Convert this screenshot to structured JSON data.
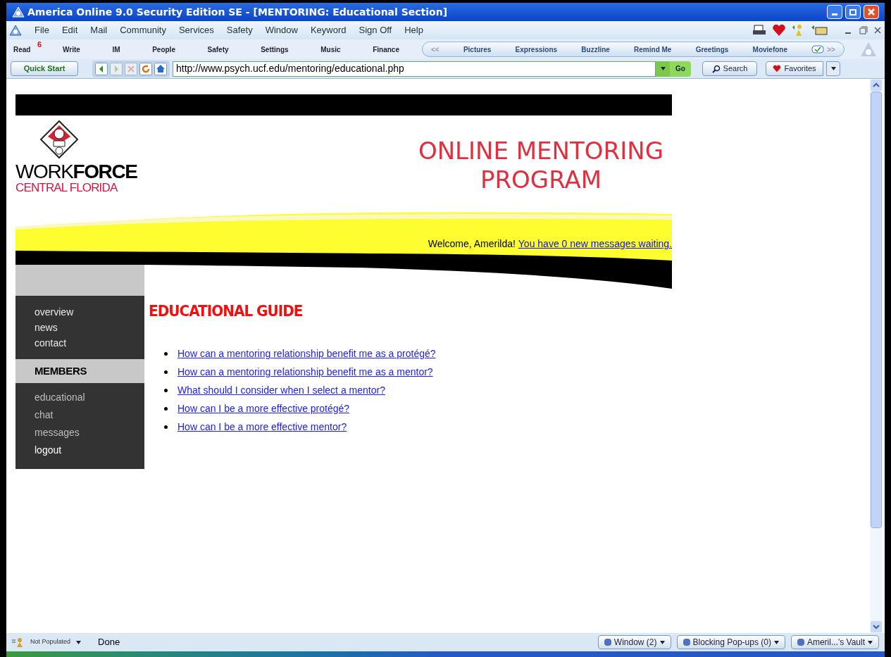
{
  "window": {
    "title": "America Online 9.0 Security Edition SE - [MENTORING: Educational Section]"
  },
  "menu": [
    "File",
    "Edit",
    "Mail",
    "Community",
    "Services",
    "Safety",
    "Window",
    "Keyword",
    "Sign Off",
    "Help"
  ],
  "toolbar": [
    {
      "label": "Read",
      "badge": "6"
    },
    {
      "label": "Write"
    },
    {
      "label": "IM"
    },
    {
      "label": "People"
    },
    {
      "label": "Safety"
    },
    {
      "label": "Settings"
    },
    {
      "label": "Music"
    },
    {
      "label": "Finance"
    }
  ],
  "toolbar2": {
    "back": "<<",
    "items": [
      "Pictures",
      "Expressions",
      "Buzzline",
      "Remind Me",
      "Greetings",
      "Moviefone"
    ],
    "more": ">>"
  },
  "address_bar": {
    "quick_start": "Quick Start",
    "url": "http://www.psych.ucf.edu/mentoring/educational.php",
    "go": "Go",
    "search": "Search",
    "favorites": "Favorites"
  },
  "page": {
    "logo": {
      "line1_thin": "WORK",
      "line1_bold": "FORCE",
      "line2": "CENTRAL FLORIDA"
    },
    "title_lines": [
      "ONLINE MENTORING",
      "PROGRAM"
    ],
    "welcome": "Welcome, Amerilda!",
    "messages_link": "You have 0 new messages waiting.",
    "nav": [
      {
        "label": "overview",
        "bright": false
      },
      {
        "label": "news",
        "bright": false
      },
      {
        "label": "contact",
        "bright": false
      }
    ],
    "members_heading": "MEMBERS",
    "members_nav": [
      {
        "label": "educational",
        "bright": false
      },
      {
        "label": "chat",
        "bright": false
      },
      {
        "label": "messages",
        "bright": false
      },
      {
        "label": "logout",
        "bright": true
      }
    ],
    "heading": "EDUCATIONAL GUIDE",
    "links": [
      "How can a mentoring relationship benefit me as a protégé?",
      "How can a mentoring relationship benefit me as a mentor?",
      "What should I consider when I select a mentor?",
      "How can I be a more effective protégé?",
      "How can I be a more effective mentor?"
    ]
  },
  "status_bar": {
    "location": "Not Populated",
    "status": "Done",
    "buttons": [
      "Window (2)",
      "Blocking Pop-ups (0)",
      "Ameril...'s Vault"
    ]
  }
}
